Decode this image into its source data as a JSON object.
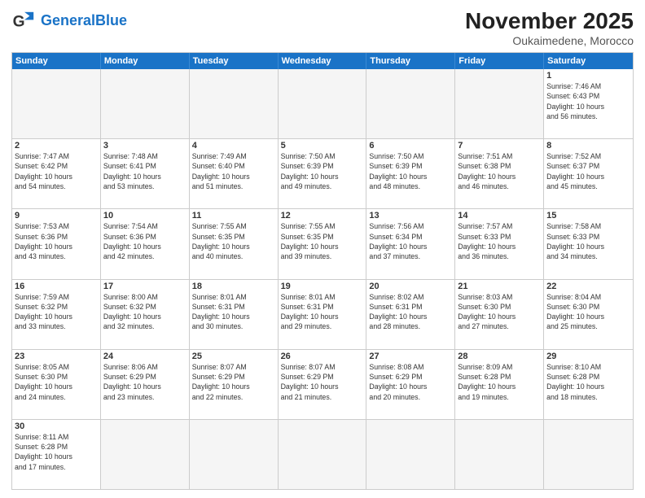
{
  "logo": {
    "general": "General",
    "blue": "Blue"
  },
  "header": {
    "month": "November 2025",
    "location": "Oukaimedene, Morocco"
  },
  "days": [
    "Sunday",
    "Monday",
    "Tuesday",
    "Wednesday",
    "Thursday",
    "Friday",
    "Saturday"
  ],
  "rows": [
    [
      {
        "day": "",
        "info": "",
        "empty": true
      },
      {
        "day": "",
        "info": "",
        "empty": true
      },
      {
        "day": "",
        "info": "",
        "empty": true
      },
      {
        "day": "",
        "info": "",
        "empty": true
      },
      {
        "day": "",
        "info": "",
        "empty": true
      },
      {
        "day": "",
        "info": "",
        "empty": true
      },
      {
        "day": "1",
        "info": "Sunrise: 7:46 AM\nSunset: 6:43 PM\nDaylight: 10 hours\nand 56 minutes."
      }
    ],
    [
      {
        "day": "2",
        "info": "Sunrise: 7:47 AM\nSunset: 6:42 PM\nDaylight: 10 hours\nand 54 minutes."
      },
      {
        "day": "3",
        "info": "Sunrise: 7:48 AM\nSunset: 6:41 PM\nDaylight: 10 hours\nand 53 minutes."
      },
      {
        "day": "4",
        "info": "Sunrise: 7:49 AM\nSunset: 6:40 PM\nDaylight: 10 hours\nand 51 minutes."
      },
      {
        "day": "5",
        "info": "Sunrise: 7:50 AM\nSunset: 6:39 PM\nDaylight: 10 hours\nand 49 minutes."
      },
      {
        "day": "6",
        "info": "Sunrise: 7:50 AM\nSunset: 6:39 PM\nDaylight: 10 hours\nand 48 minutes."
      },
      {
        "day": "7",
        "info": "Sunrise: 7:51 AM\nSunset: 6:38 PM\nDaylight: 10 hours\nand 46 minutes."
      },
      {
        "day": "8",
        "info": "Sunrise: 7:52 AM\nSunset: 6:37 PM\nDaylight: 10 hours\nand 45 minutes."
      }
    ],
    [
      {
        "day": "9",
        "info": "Sunrise: 7:53 AM\nSunset: 6:36 PM\nDaylight: 10 hours\nand 43 minutes."
      },
      {
        "day": "10",
        "info": "Sunrise: 7:54 AM\nSunset: 6:36 PM\nDaylight: 10 hours\nand 42 minutes."
      },
      {
        "day": "11",
        "info": "Sunrise: 7:55 AM\nSunset: 6:35 PM\nDaylight: 10 hours\nand 40 minutes."
      },
      {
        "day": "12",
        "info": "Sunrise: 7:55 AM\nSunset: 6:35 PM\nDaylight: 10 hours\nand 39 minutes."
      },
      {
        "day": "13",
        "info": "Sunrise: 7:56 AM\nSunset: 6:34 PM\nDaylight: 10 hours\nand 37 minutes."
      },
      {
        "day": "14",
        "info": "Sunrise: 7:57 AM\nSunset: 6:33 PM\nDaylight: 10 hours\nand 36 minutes."
      },
      {
        "day": "15",
        "info": "Sunrise: 7:58 AM\nSunset: 6:33 PM\nDaylight: 10 hours\nand 34 minutes."
      }
    ],
    [
      {
        "day": "16",
        "info": "Sunrise: 7:59 AM\nSunset: 6:32 PM\nDaylight: 10 hours\nand 33 minutes."
      },
      {
        "day": "17",
        "info": "Sunrise: 8:00 AM\nSunset: 6:32 PM\nDaylight: 10 hours\nand 32 minutes."
      },
      {
        "day": "18",
        "info": "Sunrise: 8:01 AM\nSunset: 6:31 PM\nDaylight: 10 hours\nand 30 minutes."
      },
      {
        "day": "19",
        "info": "Sunrise: 8:01 AM\nSunset: 6:31 PM\nDaylight: 10 hours\nand 29 minutes."
      },
      {
        "day": "20",
        "info": "Sunrise: 8:02 AM\nSunset: 6:31 PM\nDaylight: 10 hours\nand 28 minutes."
      },
      {
        "day": "21",
        "info": "Sunrise: 8:03 AM\nSunset: 6:30 PM\nDaylight: 10 hours\nand 27 minutes."
      },
      {
        "day": "22",
        "info": "Sunrise: 8:04 AM\nSunset: 6:30 PM\nDaylight: 10 hours\nand 25 minutes."
      }
    ],
    [
      {
        "day": "23",
        "info": "Sunrise: 8:05 AM\nSunset: 6:30 PM\nDaylight: 10 hours\nand 24 minutes."
      },
      {
        "day": "24",
        "info": "Sunrise: 8:06 AM\nSunset: 6:29 PM\nDaylight: 10 hours\nand 23 minutes."
      },
      {
        "day": "25",
        "info": "Sunrise: 8:07 AM\nSunset: 6:29 PM\nDaylight: 10 hours\nand 22 minutes."
      },
      {
        "day": "26",
        "info": "Sunrise: 8:07 AM\nSunset: 6:29 PM\nDaylight: 10 hours\nand 21 minutes."
      },
      {
        "day": "27",
        "info": "Sunrise: 8:08 AM\nSunset: 6:29 PM\nDaylight: 10 hours\nand 20 minutes."
      },
      {
        "day": "28",
        "info": "Sunrise: 8:09 AM\nSunset: 6:28 PM\nDaylight: 10 hours\nand 19 minutes."
      },
      {
        "day": "29",
        "info": "Sunrise: 8:10 AM\nSunset: 6:28 PM\nDaylight: 10 hours\nand 18 minutes."
      }
    ],
    [
      {
        "day": "30",
        "info": "Sunrise: 8:11 AM\nSunset: 6:28 PM\nDaylight: 10 hours\nand 17 minutes."
      },
      {
        "day": "",
        "info": "",
        "empty": true
      },
      {
        "day": "",
        "info": "",
        "empty": true
      },
      {
        "day": "",
        "info": "",
        "empty": true
      },
      {
        "day": "",
        "info": "",
        "empty": true
      },
      {
        "day": "",
        "info": "",
        "empty": true
      },
      {
        "day": "",
        "info": "",
        "empty": true
      }
    ]
  ]
}
